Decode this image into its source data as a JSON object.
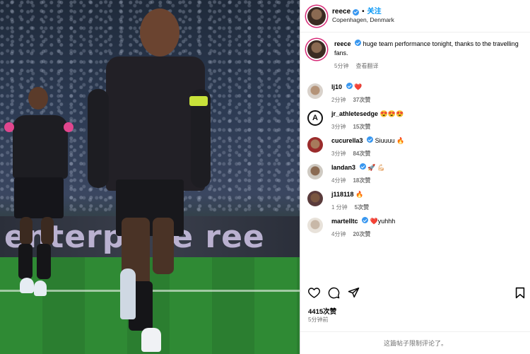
{
  "post": {
    "username": "reece",
    "follow_label": "关注",
    "separator": "•",
    "location": "Copenhagen, Denmark",
    "caption": "huge team performance tonight, thanks to the travelling fans.",
    "caption_time": "5分钟",
    "translate_label": "查看翻译",
    "likes_total": "4415次赞",
    "post_time": "5分钟前",
    "comments_limited": "这篇帖子限制评论了。"
  },
  "photo": {
    "ad_text": "enterprise ree"
  },
  "comments": [
    {
      "user": "lj10",
      "text": "❤️",
      "time": "2分钟",
      "likes": "37次赞",
      "verified": true
    },
    {
      "user": "jr_athletesedge",
      "text": "😍😍😍",
      "time": "3分钟",
      "likes": "15次赞",
      "verified": false
    },
    {
      "user": "cucurella3",
      "text": "Siuuuu 🔥",
      "time": "3分钟",
      "likes": "84次赞",
      "verified": true
    },
    {
      "user": "landan3",
      "text": "🚀 💪🏻",
      "time": "4分钟",
      "likes": "18次赞",
      "verified": true
    },
    {
      "user": "j118118",
      "text": "🔥",
      "time": "1 分钟",
      "likes": "5次赞",
      "verified": false
    },
    {
      "user": "martelltc",
      "text": "❤️yuhhh",
      "time": "4分钟",
      "likes": "20次赞",
      "verified": true
    }
  ],
  "icons": {
    "like": "heart-icon",
    "comment": "comment-icon",
    "share": "share-icon",
    "save": "bookmark-icon"
  },
  "colors": {
    "follow": "#0095f6",
    "verified": "#3897f0",
    "story_ring": "#d62976",
    "meta_text": "#737373"
  }
}
